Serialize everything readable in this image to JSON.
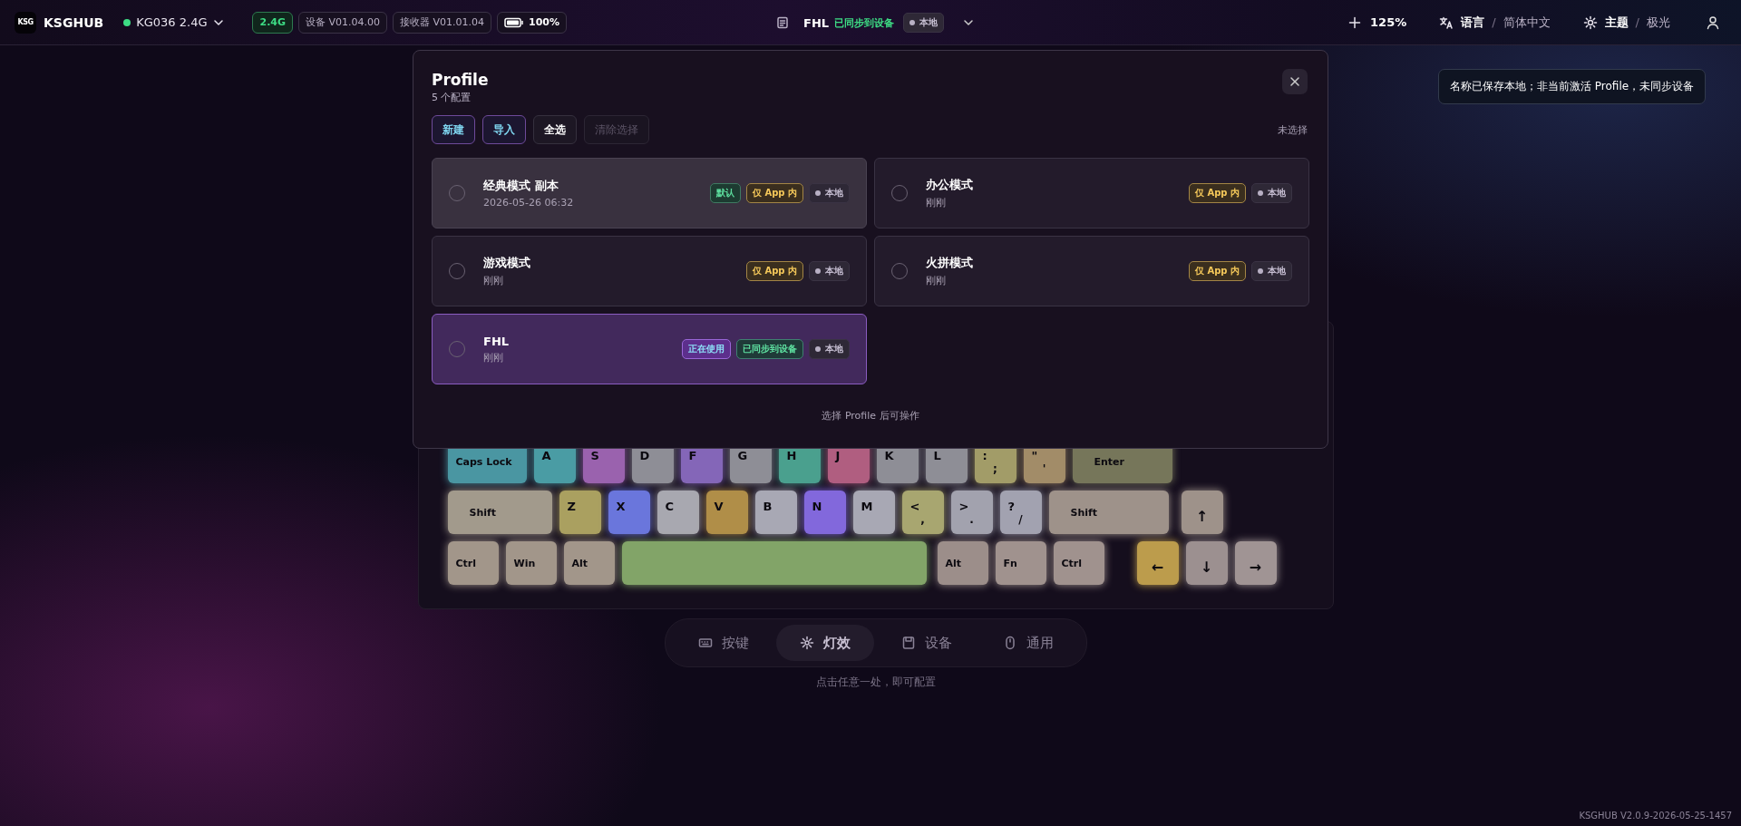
{
  "top_bar": {
    "logo": "KSG",
    "app_name": "KSGHUB",
    "device": {
      "name": "KG036 2.4G",
      "connected": true
    },
    "badges": [
      {
        "text": "2.4G",
        "kind": "signal"
      },
      {
        "text": "设备 V01.04.00",
        "kind": "plain"
      },
      {
        "text": "接收器 V01.01.04",
        "kind": "plain"
      },
      {
        "text": "100%",
        "kind": "battery"
      }
    ],
    "profile": {
      "name": "FHL",
      "sync_status": "已同步到设备",
      "storage": "本地"
    },
    "zoom": "125%",
    "language": {
      "label": "语言",
      "separator": "/",
      "value": "简体中文"
    },
    "theme": {
      "label": "主题",
      "separator": "/",
      "value": "极光"
    }
  },
  "toast": "名称已保存本地；非当前激活 Profile，未同步设备",
  "dialog": {
    "title": "Profile",
    "count": "5 个配置",
    "buttons": [
      {
        "label": "新建",
        "kind": "accent",
        "disabled": false
      },
      {
        "label": "导入",
        "kind": "accent",
        "disabled": false
      },
      {
        "label": "全选",
        "kind": "plain",
        "disabled": false
      },
      {
        "label": "清除选择",
        "kind": "plain",
        "disabled": true
      }
    ],
    "selection_status": "未选择",
    "profiles": [
      {
        "name": "经典模式 副本",
        "time": "2026-05-26 06:32",
        "checked": false,
        "hovered": true,
        "active": false,
        "tags": [
          {
            "text": "默认",
            "kind": "default"
          },
          {
            "text": "仅 App 内",
            "kind": "app"
          },
          {
            "text": "本地",
            "kind": "local"
          }
        ]
      },
      {
        "name": "办公模式",
        "time": "刚刚",
        "checked": false,
        "hovered": false,
        "active": false,
        "tags": [
          {
            "text": "仅 App 内",
            "kind": "app"
          },
          {
            "text": "本地",
            "kind": "local"
          }
        ]
      },
      {
        "name": "游戏模式",
        "time": "刚刚",
        "checked": false,
        "hovered": false,
        "active": false,
        "tags": [
          {
            "text": "仅 App 内",
            "kind": "app"
          },
          {
            "text": "本地",
            "kind": "local"
          }
        ]
      },
      {
        "name": "火拼模式",
        "time": "刚刚",
        "checked": false,
        "hovered": false,
        "active": false,
        "tags": [
          {
            "text": "仅 App 内",
            "kind": "app"
          },
          {
            "text": "本地",
            "kind": "local"
          }
        ]
      },
      {
        "name": "FHL",
        "time": "刚刚",
        "checked": false,
        "hovered": false,
        "active": true,
        "tags": [
          {
            "text": "正在使用",
            "kind": "in-use"
          },
          {
            "text": "已同步到设备",
            "kind": "synced"
          },
          {
            "text": "本地",
            "kind": "local"
          }
        ]
      }
    ],
    "footer": "选择 Profile 后可操作"
  },
  "keyboard": {
    "rows": [
      [
        {
          "label": "Caps Lock",
          "kind": "caps",
          "color": "#4a96a2"
        },
        {
          "label": "A",
          "kind": "key",
          "color": "#4a9ca4"
        },
        {
          "label": "S",
          "kind": "key",
          "color": "#9a62ae"
        },
        {
          "label": "D",
          "kind": "key",
          "color": "#8e8e96"
        },
        {
          "label": "F",
          "kind": "key",
          "color": "#8466b8"
        },
        {
          "label": "G",
          "kind": "key",
          "color": "#8e8e96"
        },
        {
          "label": "H",
          "kind": "key",
          "color": "#4aa08e"
        },
        {
          "label": "J",
          "kind": "key",
          "color": "#b05e80"
        },
        {
          "label": "K",
          "kind": "key",
          "color": "#8e8e96"
        },
        {
          "label": "L",
          "kind": "key",
          "color": "#8e8e96"
        },
        {
          "label": ":",
          "sub": ";",
          "kind": "key",
          "color": "#a29c68"
        },
        {
          "label": "\"",
          "sub": "'",
          "kind": "key",
          "color": "#a28c68"
        },
        {
          "label": "Enter",
          "kind": "enter",
          "color": "#76765a"
        }
      ],
      [
        {
          "label": "Shift",
          "kind": "lshift",
          "color": "#a29a8c"
        },
        {
          "label": "Z",
          "kind": "key",
          "color": "#aaa060"
        },
        {
          "label": "X",
          "kind": "key",
          "color": "#6a76dc"
        },
        {
          "label": "C",
          "kind": "key",
          "color": "#a8a8b0"
        },
        {
          "label": "V",
          "kind": "key",
          "color": "#b08e48"
        },
        {
          "label": "B",
          "kind": "key",
          "color": "#a8a8b4"
        },
        {
          "label": "N",
          "kind": "key",
          "color": "#8268dc"
        },
        {
          "label": "M",
          "kind": "key",
          "color": "#a8a8b4"
        },
        {
          "label": "<",
          "sub": ",",
          "kind": "key",
          "color": "#a8a670"
        },
        {
          "label": ">",
          "sub": ".",
          "kind": "key",
          "color": "#a2a2ae"
        },
        {
          "label": "?",
          "sub": "/",
          "kind": "key",
          "color": "#a2a2b0"
        },
        {
          "label": "Shift",
          "kind": "rshift",
          "color": "#9e928a"
        },
        {
          "label": "↑",
          "kind": "arrow",
          "color": "#9e928a"
        }
      ],
      [
        {
          "label": "Ctrl",
          "kind": "mod",
          "color": "#a2968a"
        },
        {
          "label": "Win",
          "kind": "mod",
          "color": "#a2968a"
        },
        {
          "label": "Alt",
          "kind": "mod",
          "color": "#a2968a"
        },
        {
          "kind": "space",
          "color": "#82a468"
        },
        {
          "label": "Alt",
          "kind": "mod",
          "color": "#9c8e8a"
        },
        {
          "label": "Fn",
          "kind": "mod",
          "color": "#a0928e"
        },
        {
          "label": "Ctrl",
          "kind": "mod",
          "color": "#a0928e"
        },
        {
          "label": "←",
          "kind": "arrow",
          "color": "#bc9c4c"
        },
        {
          "label": "↓",
          "kind": "arrow",
          "color": "#9c9090"
        },
        {
          "label": "→",
          "kind": "arrow",
          "color": "#a09494"
        }
      ]
    ]
  },
  "nav": {
    "tabs": [
      {
        "label": "按键",
        "kind": "keys",
        "selected": false
      },
      {
        "label": "灯效",
        "kind": "lighting",
        "selected": true
      },
      {
        "label": "设备",
        "kind": "device",
        "selected": false
      },
      {
        "label": "通用",
        "kind": "general",
        "selected": false
      }
    ],
    "hint": "点击任意一处，即可配置"
  },
  "version": "KSGHUB V2.0.9-2026-05-25-1457"
}
